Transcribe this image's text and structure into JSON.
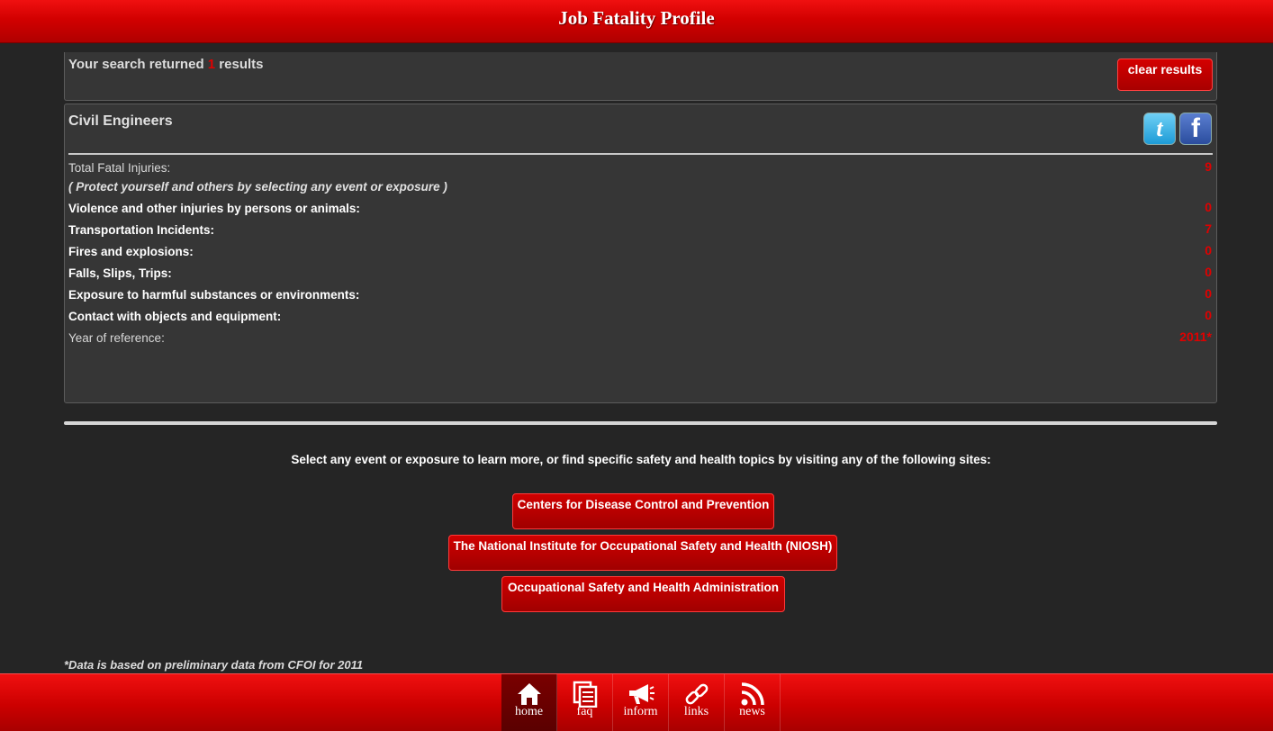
{
  "header": {
    "title": "Job Fatality Profile"
  },
  "search": {
    "prefix": "Your search returned",
    "count": "1",
    "suffix": "results",
    "clear_label": "clear results"
  },
  "result": {
    "occupation": "Civil Engineers",
    "social": {
      "twitter_glyph": "t",
      "facebook_glyph": "f"
    },
    "total_label": "Total Fatal Injuries:",
    "total_value": "9",
    "note": "( Protect yourself and others by selecting any event or exposure )",
    "rows": [
      {
        "label": "Violence and other injuries by persons or animals:",
        "value": "0"
      },
      {
        "label": "Transportation Incidents:",
        "value": "7"
      },
      {
        "label": "Fires and explosions:",
        "value": "0"
      },
      {
        "label": "Falls, Slips, Trips:",
        "value": "0"
      },
      {
        "label": "Exposure to harmful substances or environments:",
        "value": "0"
      },
      {
        "label": "Contact with objects and equipment:",
        "value": "0"
      }
    ],
    "year_label": "Year of reference:",
    "year_value": "2011*"
  },
  "info": {
    "message": "Select any event or exposure to learn more, or find specific safety and health topics by visiting any of the following sites:",
    "sites": [
      "Centers for Disease Control and Prevention",
      "The National Institute for Occupational Safety and Health (NIOSH)",
      "Occupational Safety and Health Administration"
    ]
  },
  "footnote": "*Data is based on preliminary data from CFOI for 2011",
  "nav": {
    "items": [
      {
        "label": "home",
        "icon": "home-icon"
      },
      {
        "label": "faq",
        "icon": "faq-icon"
      },
      {
        "label": "inform",
        "icon": "megaphone-icon"
      },
      {
        "label": "links",
        "icon": "link-icon"
      },
      {
        "label": "news",
        "icon": "rss-icon"
      }
    ],
    "active": "home"
  },
  "colors": {
    "accent": "#d00000",
    "value": "#e00000",
    "background": "#252525",
    "panel": "#363636"
  }
}
